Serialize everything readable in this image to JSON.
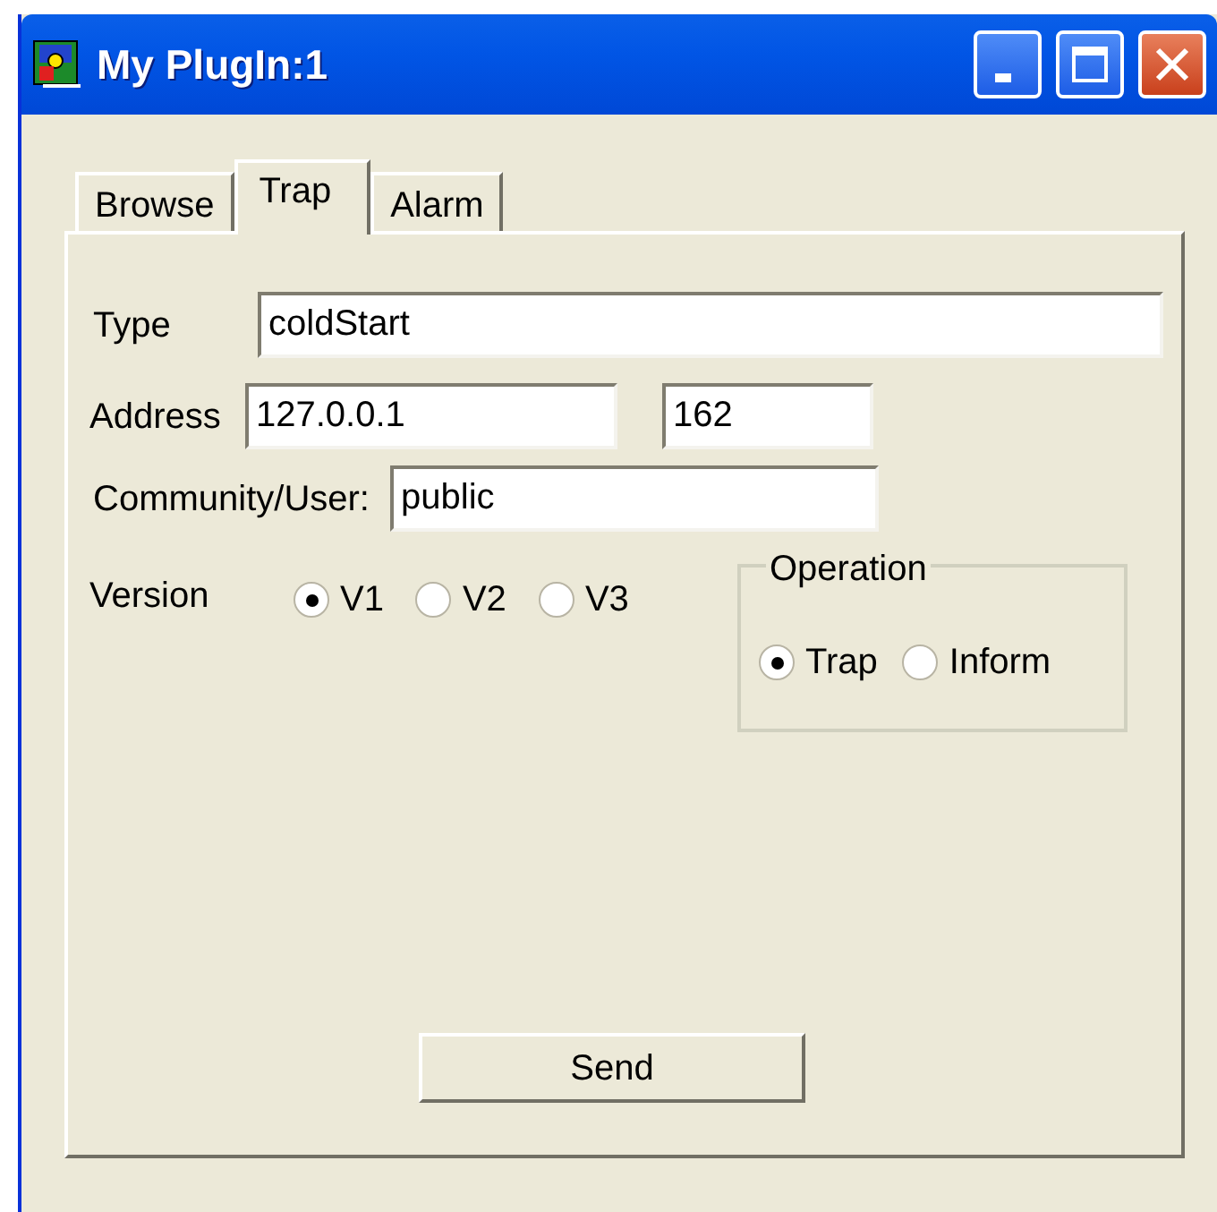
{
  "window": {
    "title": "My PlugIn:1"
  },
  "tabs": [
    {
      "label": "Browse",
      "selected": false
    },
    {
      "label": "Trap",
      "selected": true
    },
    {
      "label": "Alarm",
      "selected": false
    }
  ],
  "type": {
    "label": "Type",
    "value": "coldStart"
  },
  "address": {
    "label": "Address",
    "value": "127.0.0.1",
    "port": "162"
  },
  "community": {
    "label": "Community/User:",
    "value": "public"
  },
  "version": {
    "label": "Version",
    "options": [
      {
        "label": "V1",
        "selected": true
      },
      {
        "label": "V2",
        "selected": false
      },
      {
        "label": "V3",
        "selected": false
      }
    ]
  },
  "operation": {
    "title": "Operation",
    "options": [
      {
        "label": "Trap",
        "selected": true
      },
      {
        "label": "Inform",
        "selected": false
      }
    ]
  },
  "buttons": [
    "Send"
  ]
}
